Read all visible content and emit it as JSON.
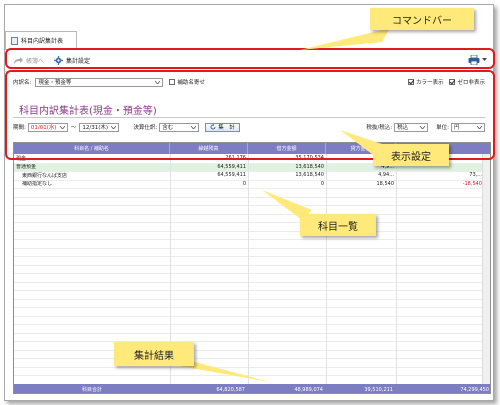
{
  "tab": {
    "label": "科目内訳集計表"
  },
  "command_bar": {
    "back_label": "帳簿へ",
    "settings_label": "集計設定"
  },
  "settings": {
    "breakdown_label": "内訳名:",
    "breakdown_value": "現金・預金等",
    "auxiliary_label": "補助名寄せ",
    "color_display_label": "カラー表示",
    "zero_hide_label": "ゼロ非表示",
    "report_title": "科目内訳集計表(現金・預金等)",
    "period_label": "期間:",
    "period_from": "01/01(水)",
    "period_sep": "〜",
    "period_to": "12/31(木)",
    "closing_label": "決算仕訳:",
    "closing_value": "含む",
    "aggregate_label": "集　計",
    "tax_label": "税抜/税込:",
    "tax_value": "税込",
    "unit_label": "単位:",
    "unit_value": "円"
  },
  "table": {
    "columns": [
      "科目名 / 補助名",
      "繰越残高",
      "借方金額",
      "貸方金額",
      "残高"
    ],
    "rows": [
      {
        "name": "現金",
        "carry": "261,176",
        "debit": "35,170,534",
        "credit": "3,...",
        "balance": ""
      },
      {
        "name": "普通預金",
        "carry": "64,559,411",
        "debit": "13,618,540",
        "credit": "4,9...",
        "balance": ""
      },
      {
        "name": "東西銀行なんば支店",
        "carry": "64,559,411",
        "debit": "13,618,540",
        "credit": "4,94...",
        "balance": "73,..."
      },
      {
        "name": "補助指定なし",
        "carry": "0",
        "debit": "0",
        "credit": "18,540",
        "balance": "-18,540"
      }
    ],
    "footer": {
      "label": "科目合計",
      "carry": "64,820,587",
      "debit": "48,989,074",
      "credit": "39,510,211",
      "balance": "74,299,450"
    }
  },
  "callouts": {
    "command_bar": "コマンドバー",
    "display_settings": "表示設定",
    "item_list": "科目一覧",
    "totals": "集計結果"
  },
  "colors": {
    "highlight": "#e01b1b",
    "callout": "#ffe97a",
    "grid_header": "#7d7dc1",
    "selected_row": "#dff1df",
    "negative": "#d21d1d"
  }
}
